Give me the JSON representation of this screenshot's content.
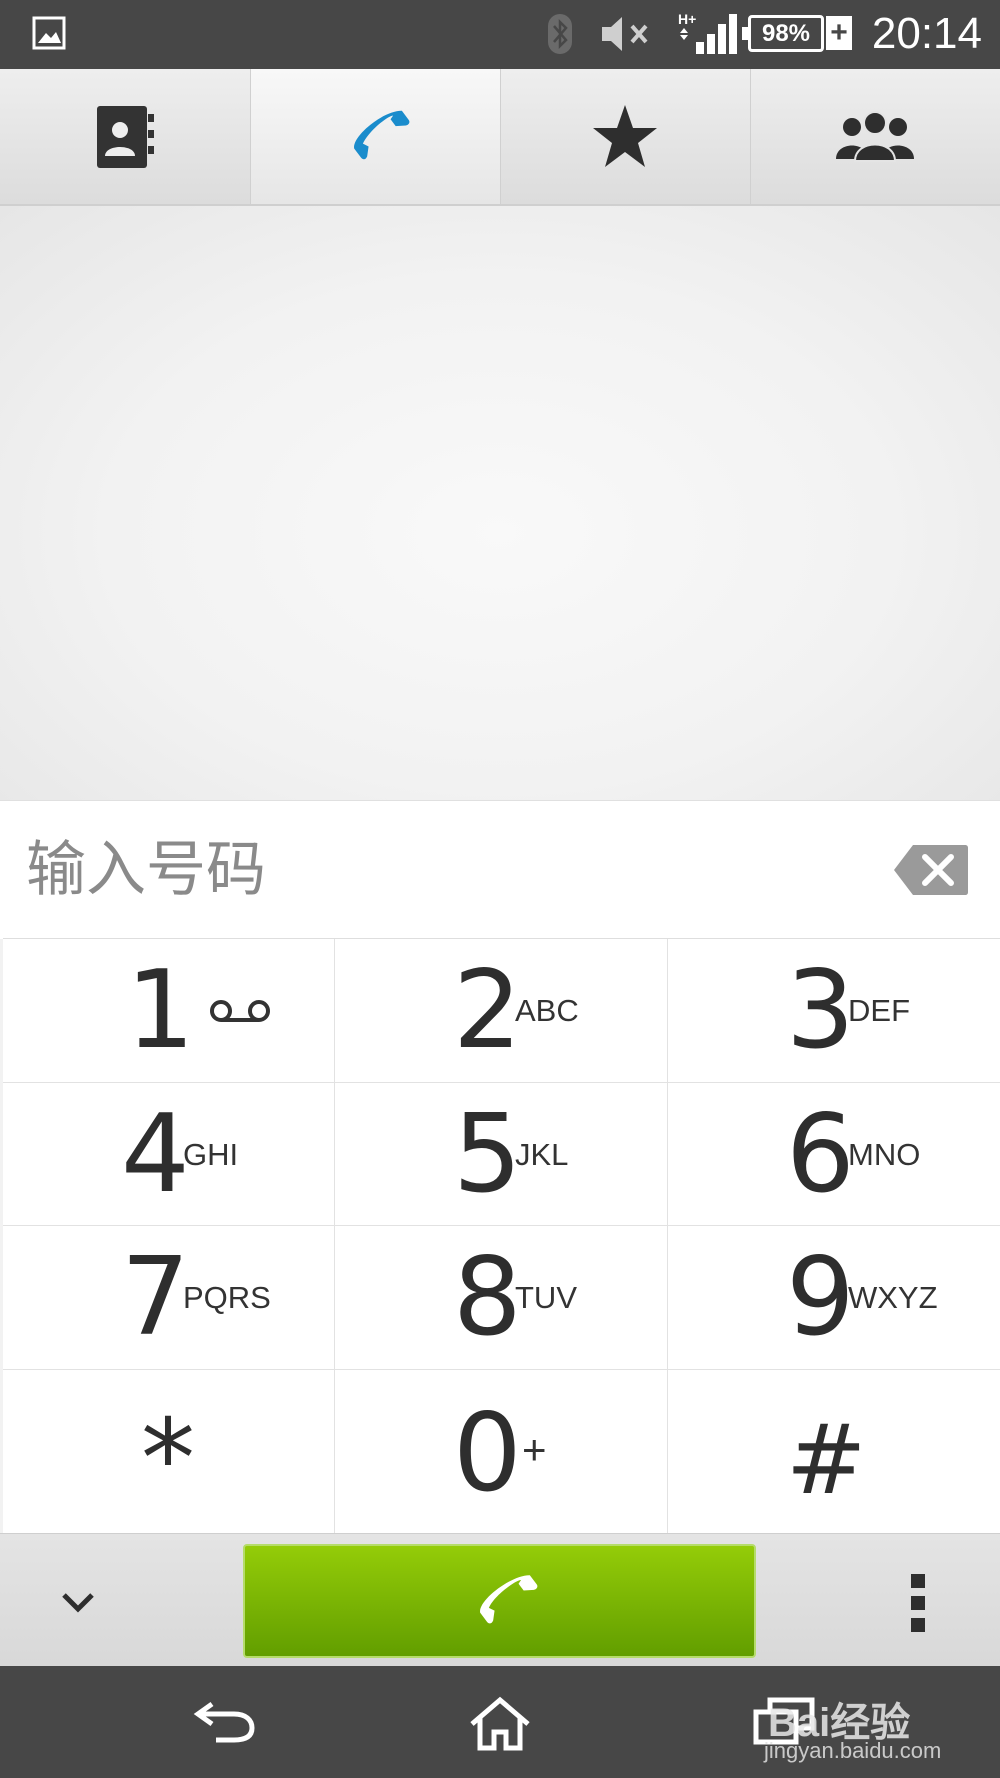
{
  "status_bar": {
    "battery_percent": "98%",
    "charging_symbol": "+",
    "network_type": "H+",
    "time": "20:14",
    "icons": [
      "gallery-icon",
      "bluetooth-icon",
      "mute-icon",
      "signal-icon",
      "battery-icon"
    ]
  },
  "tabs": [
    {
      "name": "contacts",
      "icon": "contacts-book-icon",
      "active": false
    },
    {
      "name": "phone",
      "icon": "phone-icon",
      "active": true
    },
    {
      "name": "favorites",
      "icon": "star-icon",
      "active": false
    },
    {
      "name": "groups",
      "icon": "group-icon",
      "active": false
    }
  ],
  "input": {
    "placeholder": "输入号码",
    "value": ""
  },
  "keypad": [
    {
      "digit": "1",
      "letters": "",
      "icon": "voicemail-icon"
    },
    {
      "digit": "2",
      "letters": "ABC"
    },
    {
      "digit": "3",
      "letters": "DEF"
    },
    {
      "digit": "4",
      "letters": "GHI"
    },
    {
      "digit": "5",
      "letters": "JKL"
    },
    {
      "digit": "6",
      "letters": "MNO"
    },
    {
      "digit": "7",
      "letters": "PQRS"
    },
    {
      "digit": "8",
      "letters": "TUV"
    },
    {
      "digit": "9",
      "letters": "WXYZ"
    },
    {
      "digit": "*",
      "letters": ""
    },
    {
      "digit": "0",
      "letters": "+"
    },
    {
      "digit": "#",
      "letters": ""
    }
  ],
  "bottom_bar": {
    "call_color": "#7cb800",
    "icons": [
      "chevron-down-icon",
      "call-icon",
      "overflow-menu-icon"
    ]
  },
  "nav_bar": {
    "icons": [
      "back-icon",
      "home-icon",
      "recents-icon"
    ]
  },
  "watermark": {
    "text": "Bai经验",
    "url": "jingyan.baidu.com"
  },
  "colors": {
    "accent_blue": "#1a8ccc",
    "call_green": "#7cb800",
    "bar_dark": "#474747"
  }
}
